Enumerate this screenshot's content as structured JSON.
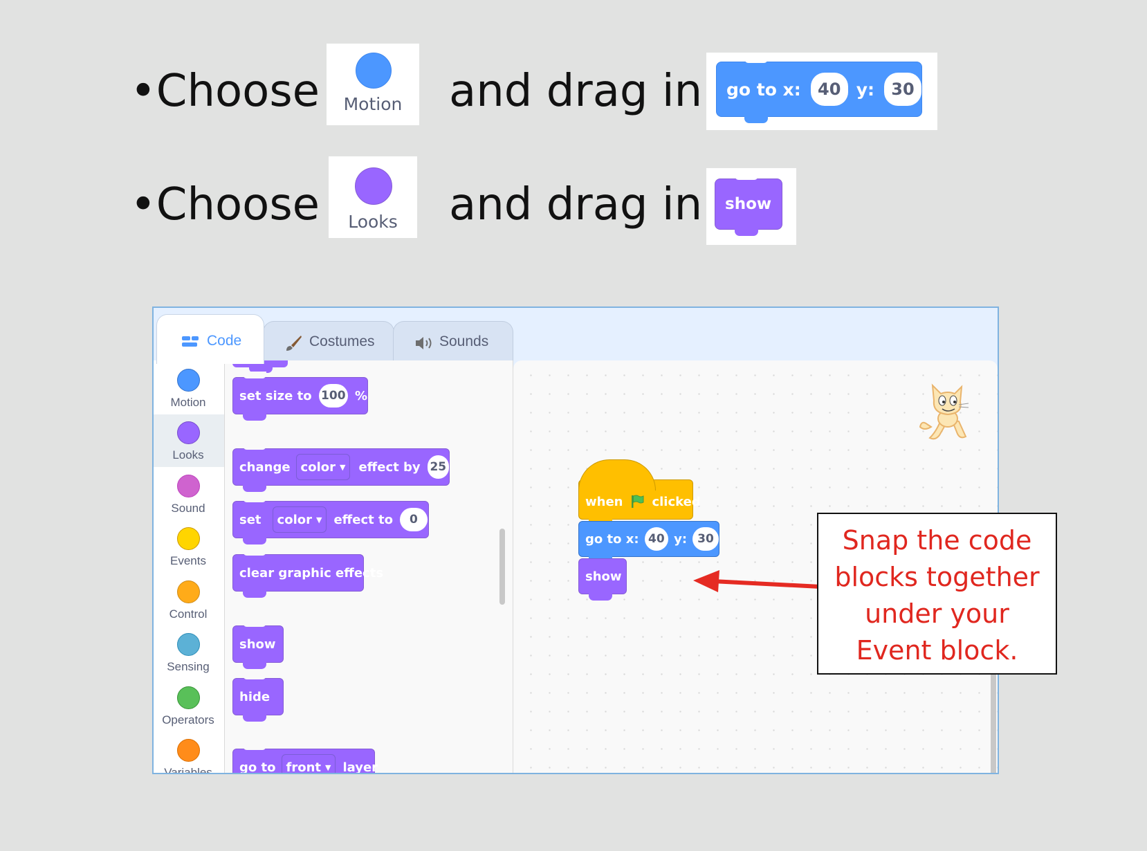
{
  "instructions": [
    {
      "bullet": "•",
      "verb": "Choose",
      "connector": "and drag in",
      "category": "Motion"
    },
    {
      "bullet": "•",
      "verb": "Choose",
      "connector": "and drag in",
      "category": "Looks"
    }
  ],
  "example_blocks": {
    "goto": {
      "label_x": "go to x:",
      "x": "40",
      "label_y": "y:",
      "y": "30"
    },
    "show": "show"
  },
  "editor": {
    "tabs": [
      {
        "label": "Code",
        "icon": "code-icon",
        "active": true
      },
      {
        "label": "Costumes",
        "icon": "brush-icon",
        "active": false
      },
      {
        "label": "Sounds",
        "icon": "speaker-icon",
        "active": false
      }
    ],
    "categories": [
      {
        "label": "Motion",
        "color": "#4c97ff"
      },
      {
        "label": "Looks",
        "color": "#9966ff"
      },
      {
        "label": "Sound",
        "color": "#cf63cf"
      },
      {
        "label": "Events",
        "color": "#ffd500"
      },
      {
        "label": "Control",
        "color": "#ffab19"
      },
      {
        "label": "Sensing",
        "color": "#5cb1d6"
      },
      {
        "label": "Operators",
        "color": "#59c059"
      },
      {
        "label": "Variables",
        "color": "#ff8c1a"
      }
    ],
    "palette": {
      "set_size": {
        "label": "set size to",
        "value": "100",
        "unit": "%"
      },
      "change_effect": {
        "label": "change",
        "effect": "color",
        "mid": "effect by",
        "value": "25"
      },
      "set_effect": {
        "label": "set",
        "effect": "color",
        "mid": "effect to",
        "value": "0"
      },
      "clear": "clear graphic effects",
      "show": "show",
      "hide": "hide",
      "goto_layer": {
        "label": "go to",
        "option": "front",
        "suffix": "layer"
      }
    },
    "script": {
      "hat": {
        "when": "when",
        "clicked": "clicked"
      },
      "goto": {
        "label_x": "go to x:",
        "x": "40",
        "label_y": "y:",
        "y": "30"
      },
      "show": "show"
    }
  },
  "callout": {
    "lines": [
      "Snap the code",
      "blocks together",
      "under your",
      "Event block."
    ]
  },
  "colors": {
    "motion": "#4c97ff",
    "looks": "#9966ff",
    "events": "#ffbf00",
    "callout_text": "#e0271f",
    "arrow": "#e52b23"
  }
}
